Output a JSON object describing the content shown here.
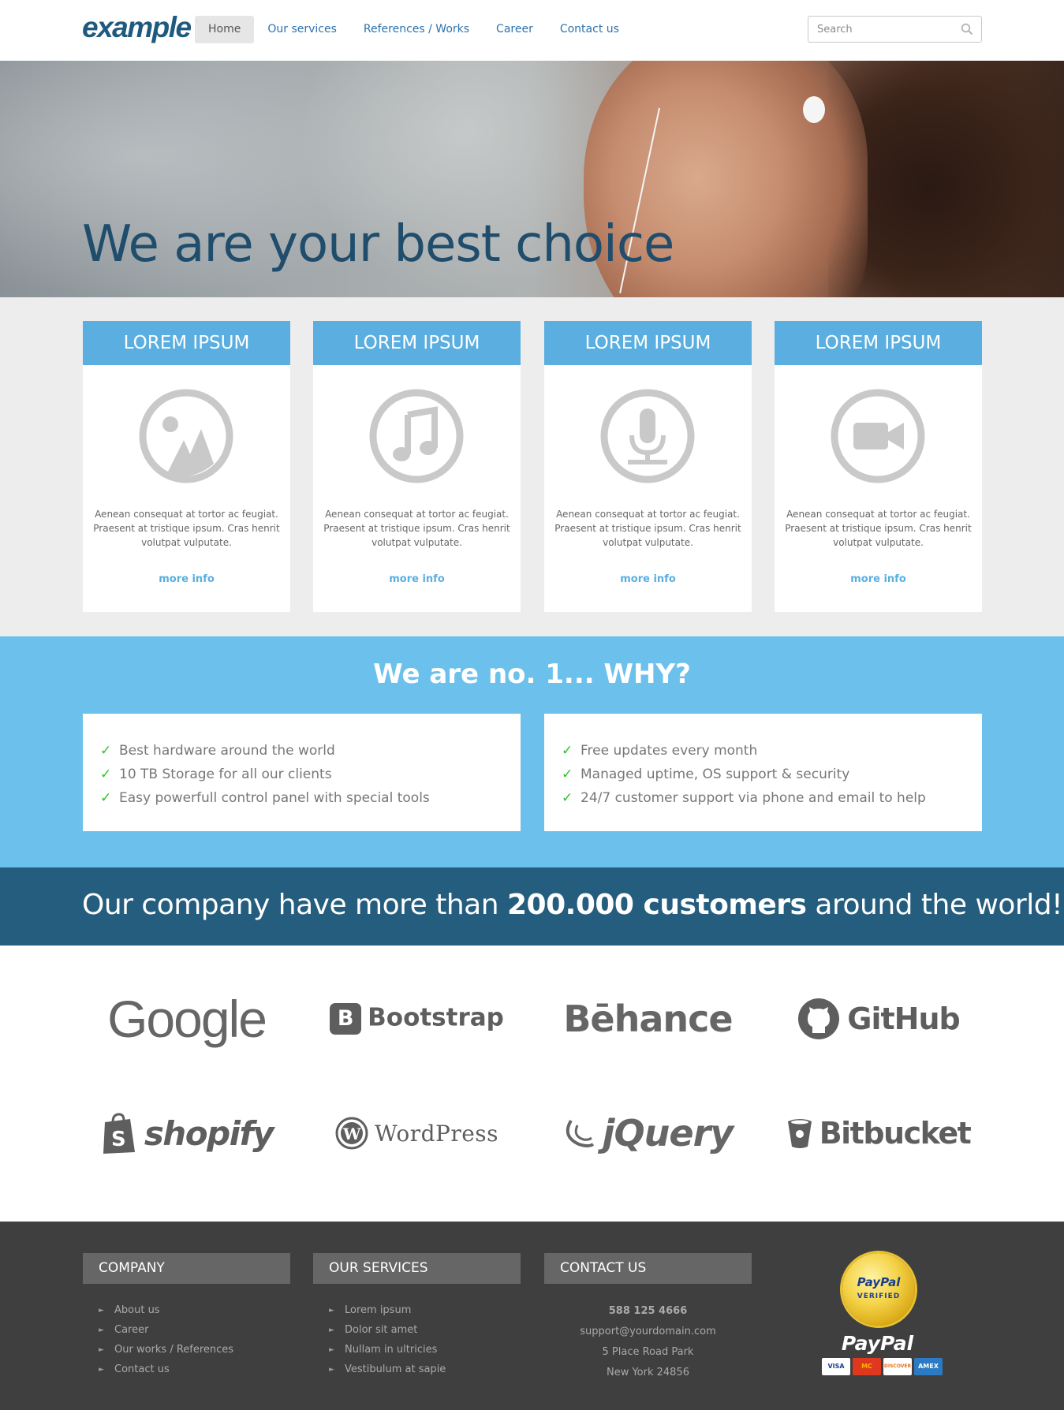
{
  "header": {
    "logo": "example",
    "nav": [
      {
        "label": "Home",
        "active": true
      },
      {
        "label": "Our services",
        "active": false
      },
      {
        "label": "References / Works",
        "active": false
      },
      {
        "label": "Career",
        "active": false
      },
      {
        "label": "Contact us",
        "active": false
      }
    ],
    "search_placeholder": "Search"
  },
  "hero": {
    "title": "We are your best choice"
  },
  "cards": [
    {
      "title": "LOREM IPSUM",
      "icon": "image-icon",
      "text": "Aenean consequat at tortor ac feugiat. Praesent at tristique ipsum. Cras henrit volutpat vulputate.",
      "link": "more info"
    },
    {
      "title": "LOREM IPSUM",
      "icon": "music-icon",
      "text": "Aenean consequat at tortor ac feugiat. Praesent at tristique ipsum. Cras henrit volutpat vulputate.",
      "link": "more info"
    },
    {
      "title": "LOREM IPSUM",
      "icon": "microphone-icon",
      "text": "Aenean consequat at tortor ac feugiat. Praesent at tristique ipsum. Cras henrit volutpat vulputate.",
      "link": "more info"
    },
    {
      "title": "LOREM IPSUM",
      "icon": "video-camera-icon",
      "text": "Aenean consequat at tortor ac feugiat. Praesent at tristique ipsum. Cras henrit volutpat vulputate.",
      "link": "more info"
    }
  ],
  "why": {
    "title_prefix": "We are no. 1...",
    "title_strong": "WHY?",
    "left": [
      "Best hardware around the world",
      "10 TB Storage for all our clients",
      "Easy powerfull control panel with special tools"
    ],
    "right": [
      "Free updates every month",
      "Managed uptime, OS support & security",
      "24/7 customer support via phone and email to help"
    ]
  },
  "banner": {
    "prefix": "Our company have more than",
    "strong": "200.000 customers",
    "suffix": "around the world!"
  },
  "logos": [
    "Google",
    "Bootstrap",
    "Bēhance",
    "GitHub",
    "shopify",
    "WordPress",
    "jQuery",
    "Bitbucket"
  ],
  "footer": {
    "company": {
      "title": "COMPANY",
      "items": [
        "About us",
        "Career",
        "Our works / References",
        "Contact us"
      ]
    },
    "services": {
      "title": "OUR SERVICES",
      "items": [
        "Lorem ipsum",
        "Dolor sit amet",
        "Nullam in ultricies",
        "Vestibulum at sapie"
      ]
    },
    "contact": {
      "title": "CONTACT US",
      "phone": "588 125 4666",
      "email": "support@yourdomain.com",
      "address1": "5 Place Road Park",
      "address2": "New York 24856"
    },
    "paypal": {
      "seal_line1": "PayPal",
      "seal_line2": "VERIFIED",
      "wordmark": "PayPal",
      "cards": [
        "VISA",
        "MC",
        "DISCOVER",
        "AMEX"
      ]
    }
  },
  "colors": {
    "brand_dark": "#1f5a7e",
    "card_header": "#5aafe0",
    "why_bg": "#6cc1ec",
    "banner_bg": "#255d7e",
    "footer_bg": "#3f3f3f",
    "check": "#2ec12e"
  }
}
